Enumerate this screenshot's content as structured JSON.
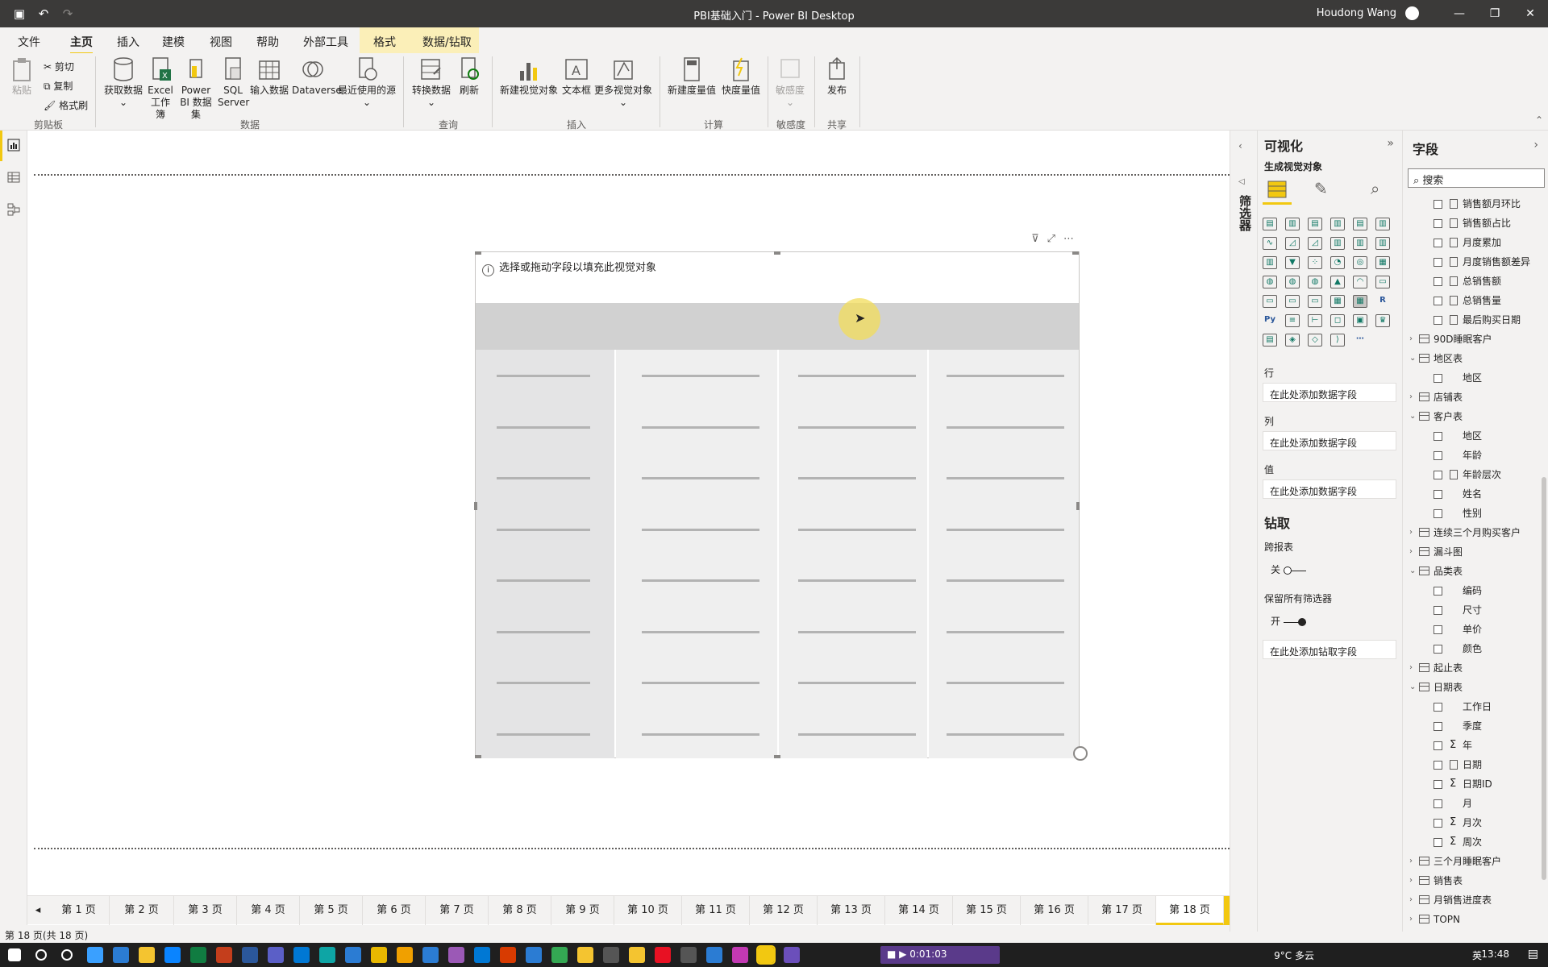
{
  "window": {
    "title": "PBI基础入门 - Power BI Desktop",
    "user": "Houdong Wang"
  },
  "menu": {
    "tabs": [
      "文件",
      "主页",
      "插入",
      "建模",
      "视图",
      "帮助",
      "外部工具",
      "格式",
      "数据/钻取"
    ],
    "active": "主页"
  },
  "ribbon": {
    "clipboard": {
      "paste": "粘贴",
      "cut": "剪切",
      "copy": "复制",
      "format_painter": "格式刷",
      "group": "剪贴板"
    },
    "data": {
      "get_data": "获取数据",
      "excel": "Excel 工作簿",
      "pbi": "Power BI 数据集",
      "sql": "SQL Server",
      "enter": "输入数据",
      "dataverse": "Dataverse",
      "recent": "最近使用的源",
      "group": "数据"
    },
    "query": {
      "transform": "转换数据",
      "refresh": "刷新",
      "group": "查询"
    },
    "insert": {
      "new_visual": "新建视觉对象",
      "textbox": "文本框",
      "more_visuals": "更多视觉对象",
      "group": "插入"
    },
    "calc": {
      "new_measure": "新建度量值",
      "quick_measure": "快度量值",
      "group": "计算"
    },
    "sensitivity": {
      "label": "敏感度",
      "group": "敏感度"
    },
    "share": {
      "publish": "发布",
      "group": "共享"
    }
  },
  "visual": {
    "hint": "选择或拖动字段以填充此视觉对象"
  },
  "filters": {
    "label": "筛选器"
  },
  "viz_pane": {
    "title": "可视化",
    "subtitle": "生成视觉对象",
    "wells": {
      "rows_label": "行",
      "rows": "在此处添加数据字段",
      "cols_label": "列",
      "cols": "在此处添加数据字段",
      "values_label": "值",
      "values": "在此处添加数据字段"
    },
    "drill": {
      "title": "钻取",
      "cross_report": "跨报表",
      "cross_state": "关",
      "keep_filters": "保留所有筛选器",
      "keep_state": "开",
      "drill_well": "在此处添加钻取字段"
    }
  },
  "fields_pane": {
    "title": "字段",
    "search_placeholder": "搜索",
    "items": [
      {
        "kind": "field",
        "label": "销售额月环比",
        "icon": "calc"
      },
      {
        "kind": "field",
        "label": "销售额占比",
        "icon": "calc"
      },
      {
        "kind": "field",
        "label": "月度累加",
        "icon": "calc"
      },
      {
        "kind": "field",
        "label": "月度销售额差异",
        "icon": "calc"
      },
      {
        "kind": "field",
        "label": "总销售额",
        "icon": "calc"
      },
      {
        "kind": "field",
        "label": "总销售量",
        "icon": "calc"
      },
      {
        "kind": "field",
        "label": "最后购买日期",
        "icon": "calc"
      },
      {
        "kind": "table",
        "label": "90D睡眠客户",
        "expanded": false
      },
      {
        "kind": "table",
        "label": "地区表",
        "expanded": true
      },
      {
        "kind": "field",
        "label": "地区",
        "icon": ""
      },
      {
        "kind": "table",
        "label": "店铺表",
        "expanded": false
      },
      {
        "kind": "table",
        "label": "客户表",
        "expanded": true
      },
      {
        "kind": "field",
        "label": "地区",
        "icon": ""
      },
      {
        "kind": "field",
        "label": "年龄",
        "icon": ""
      },
      {
        "kind": "field",
        "label": "年龄层次",
        "icon": "calc"
      },
      {
        "kind": "field",
        "label": "姓名",
        "icon": ""
      },
      {
        "kind": "field",
        "label": "性别",
        "icon": ""
      },
      {
        "kind": "table",
        "label": "连续三个月购买客户",
        "expanded": false
      },
      {
        "kind": "table",
        "label": "漏斗图",
        "expanded": false
      },
      {
        "kind": "table",
        "label": "品类表",
        "expanded": true
      },
      {
        "kind": "field",
        "label": "编码",
        "icon": ""
      },
      {
        "kind": "field",
        "label": "尺寸",
        "icon": ""
      },
      {
        "kind": "field",
        "label": "单价",
        "icon": ""
      },
      {
        "kind": "field",
        "label": "颜色",
        "icon": ""
      },
      {
        "kind": "table",
        "label": "起止表",
        "expanded": false
      },
      {
        "kind": "table",
        "label": "日期表",
        "expanded": true
      },
      {
        "kind": "field",
        "label": "工作日",
        "icon": ""
      },
      {
        "kind": "field",
        "label": "季度",
        "icon": ""
      },
      {
        "kind": "field",
        "label": "年",
        "icon": "sigma"
      },
      {
        "kind": "field",
        "label": "日期",
        "icon": "calc"
      },
      {
        "kind": "field",
        "label": "日期ID",
        "icon": "sigma"
      },
      {
        "kind": "field",
        "label": "月",
        "icon": ""
      },
      {
        "kind": "field",
        "label": "月次",
        "icon": "sigma"
      },
      {
        "kind": "field",
        "label": "周次",
        "icon": "sigma"
      },
      {
        "kind": "table",
        "label": "三个月睡眠客户",
        "expanded": false
      },
      {
        "kind": "table",
        "label": "销售表",
        "expanded": false
      },
      {
        "kind": "table",
        "label": "月销售进度表",
        "expanded": false
      },
      {
        "kind": "table",
        "label": "TOPN",
        "expanded": false
      }
    ]
  },
  "pages": {
    "tabs": [
      "第 1 页",
      "第 2 页",
      "第 3 页",
      "第 4 页",
      "第 5 页",
      "第 6 页",
      "第 7 页",
      "第 8 页",
      "第 9 页",
      "第 10 页",
      "第 11 页",
      "第 12 页",
      "第 13 页",
      "第 14 页",
      "第 15 页",
      "第 16 页",
      "第 17 页",
      "第 18 页"
    ],
    "active_index": 17,
    "add": "+"
  },
  "status": {
    "text": "第 18 页(共 18 页)"
  },
  "taskbar": {
    "recording": "0:01:03",
    "weather": "9°C 多云",
    "lang": "英",
    "time": "13:48"
  },
  "colors": {
    "accent": "#f2c811",
    "titlebar": "#3b3a39"
  }
}
